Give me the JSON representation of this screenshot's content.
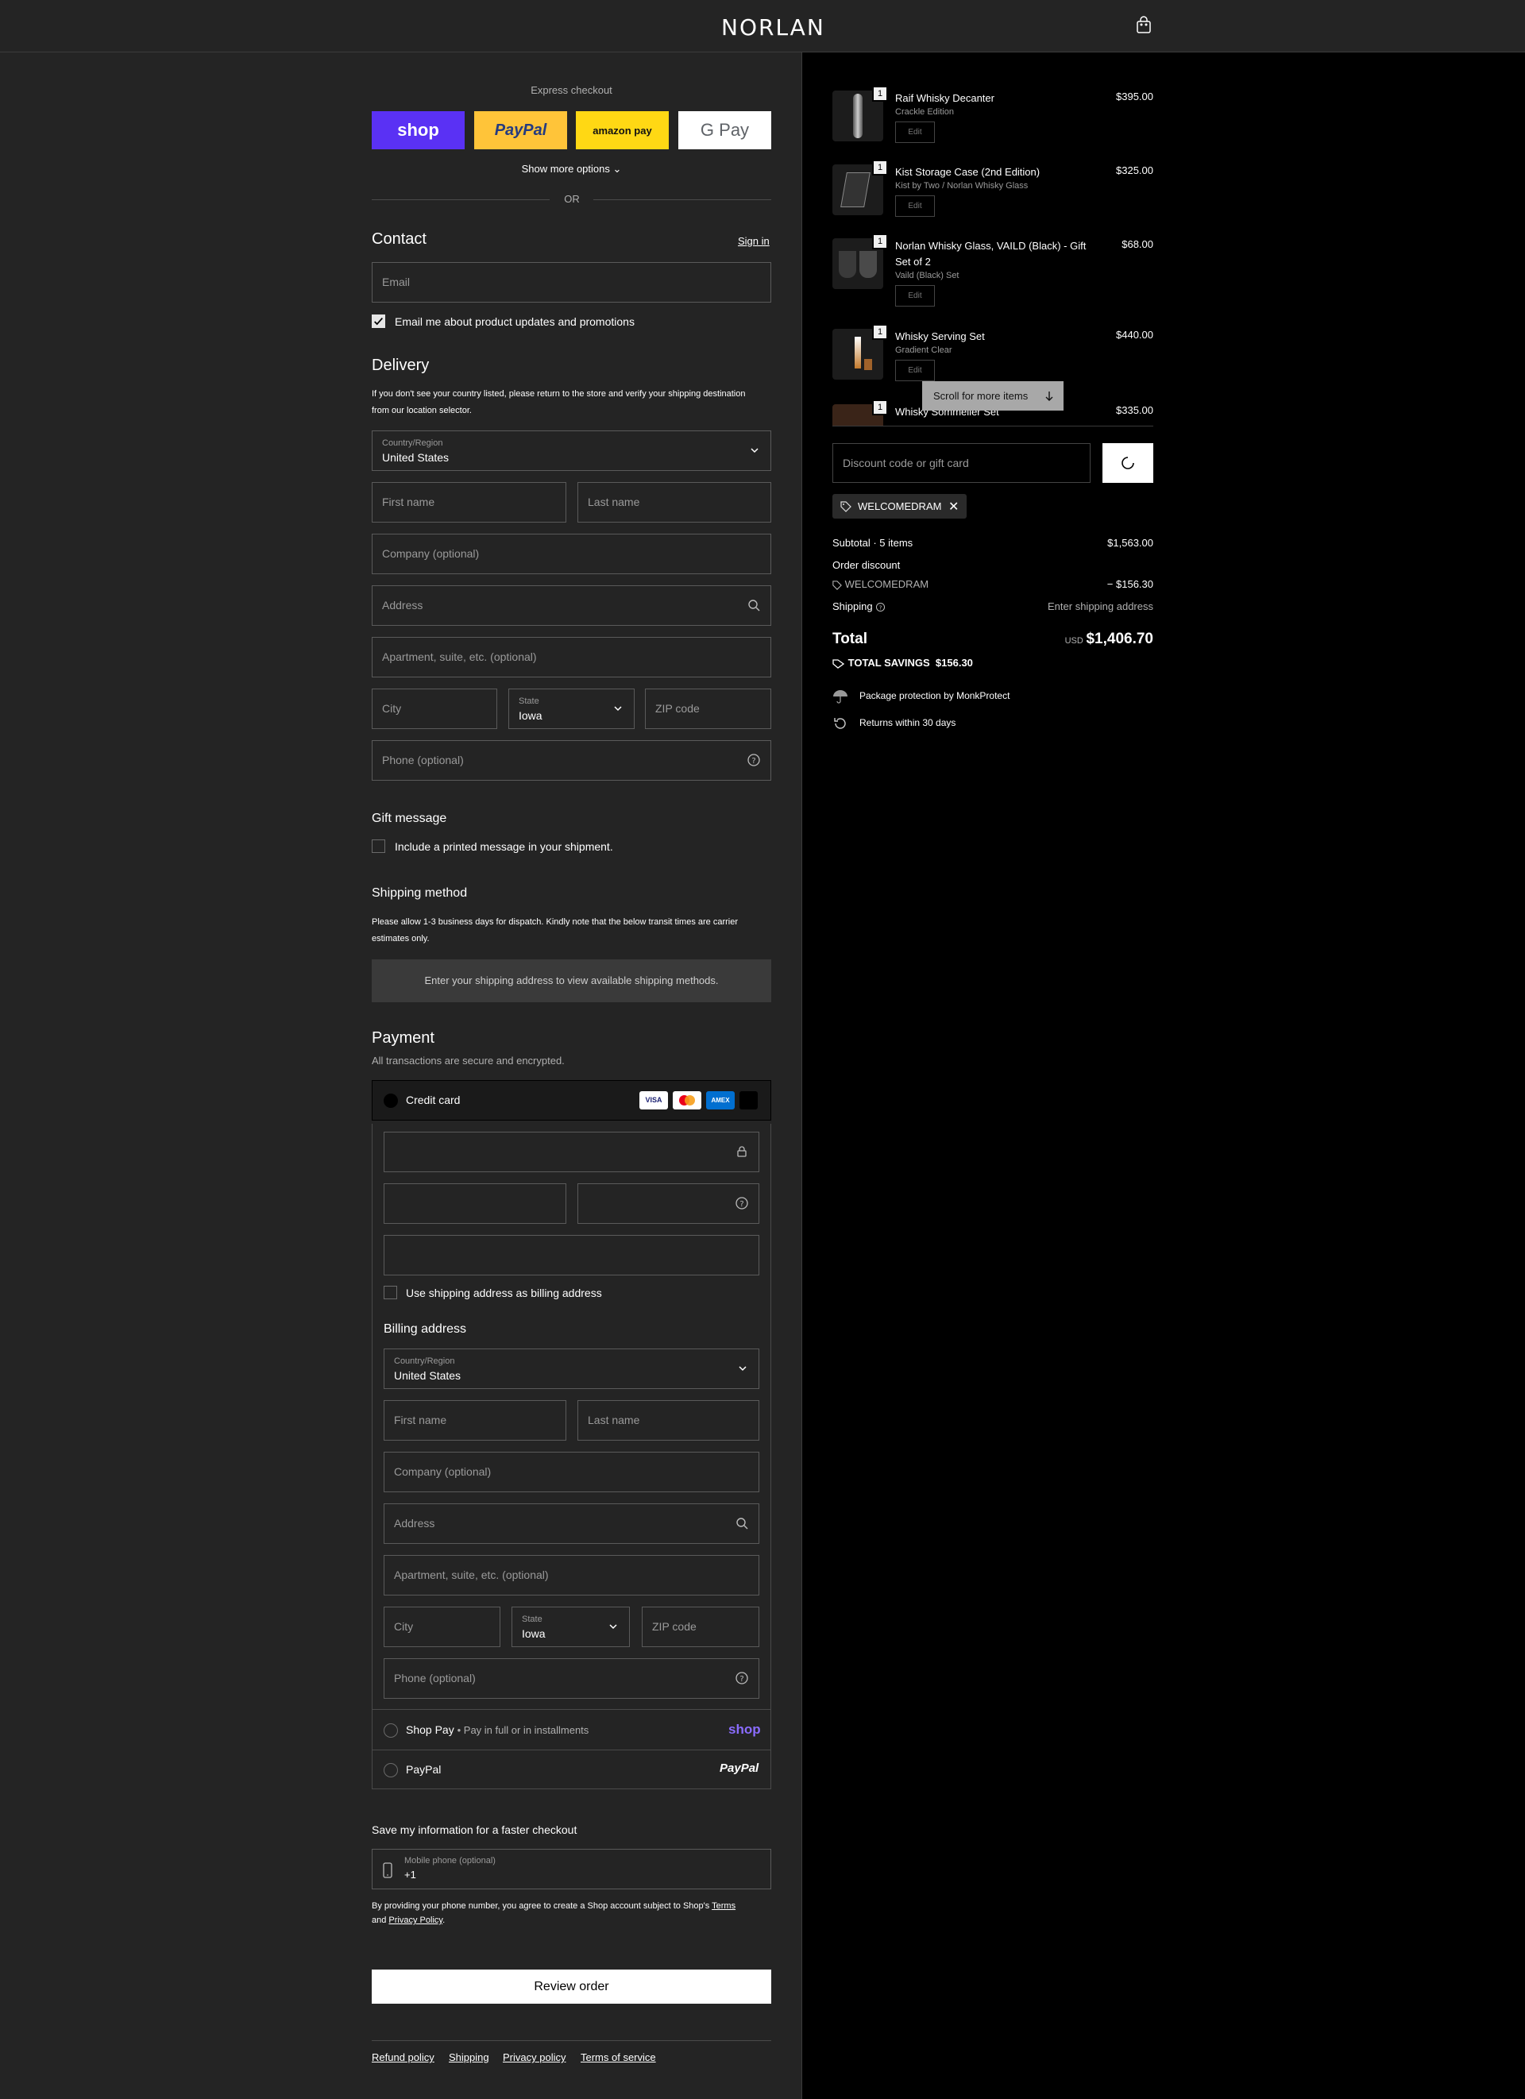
{
  "header": {
    "brand": "NORLAN",
    "cart_icon": "shopping-bag-icon"
  },
  "express": {
    "title": "Express checkout",
    "shop": "shop",
    "paypal": "PayPal",
    "amazon": "amazon pay",
    "gpay": "G Pay",
    "more": "Show more options",
    "or": "OR"
  },
  "contact": {
    "title": "Contact",
    "signin": "Sign in",
    "email_placeholder": "Email",
    "newsletter": "Email me about product updates and promotions",
    "newsletter_checked": true
  },
  "delivery": {
    "title": "Delivery",
    "note": "If you don't see your country listed, please return to the store and verify your shipping destination from our location selector.",
    "country_label": "Country/Region",
    "country": "United States",
    "first": "First name",
    "last": "Last name",
    "company": "Company (optional)",
    "address": "Address",
    "apt": "Apartment, suite, etc. (optional)",
    "city": "City",
    "state_label": "State",
    "state": "Iowa",
    "zip": "ZIP code",
    "phone": "Phone (optional)"
  },
  "gift": {
    "title": "Gift message",
    "option": "Include a printed message in your shipment."
  },
  "shipping": {
    "title": "Shipping method",
    "note": "Please allow 1-3 business days for dispatch. Kindly note that the below transit times are carrier estimates only.",
    "placeholder": "Enter your shipping address to view available shipping methods."
  },
  "payment": {
    "title": "Payment",
    "subtitle": "All transactions are secure and encrypted.",
    "credit": "Credit card",
    "cards": [
      "VISA",
      "MC",
      "AMEX",
      ""
    ],
    "use_shipping": "Use shipping address as billing address",
    "billing_title": "Billing address",
    "shoppay": "Shop Pay",
    "shoppay_sub": "Pay in full or in installments",
    "shoppay_logo": "shop",
    "paypal": "PayPal",
    "paypal_logo": "PayPal"
  },
  "save": {
    "title": "Save my information for a faster checkout",
    "phone_label": "Mobile phone (optional)",
    "phone_value": "+1",
    "terms_a": "By providing your phone number, you agree to create a Shop account subject to Shop's",
    "terms_link": "Terms",
    "terms_and": "and",
    "privacy": "Privacy Policy",
    "terms_end": "."
  },
  "review": "Review order",
  "footer": [
    "Refund policy",
    "Shipping",
    "Privacy policy",
    "Terms of service"
  ],
  "cart": {
    "items": [
      {
        "qty": "1",
        "name": "Raif Whisky Decanter",
        "variant": "Crackle Edition",
        "edit": "Edit",
        "price": "$395.00"
      },
      {
        "qty": "1",
        "name": "Kist Storage Case (2nd Edition)",
        "variant": "Kist by Two / Norlan Whisky Glass",
        "edit": "Edit",
        "price": "$325.00"
      },
      {
        "qty": "1",
        "name": "Norlan Whisky Glass, VAILD (Black) - Gift Set of 2",
        "variant": "Vaild (Black) Set",
        "edit": "Edit",
        "price": "$68.00"
      },
      {
        "qty": "1",
        "name": "Whisky Serving Set",
        "variant": "Gradient Clear",
        "edit": "Edit",
        "price": "$440.00"
      },
      {
        "qty": "1",
        "name": "Whisky Sommelier Set",
        "variant": "",
        "edit": "",
        "price": "$335.00"
      }
    ],
    "scroll_hint": "Scroll for more items",
    "discount_placeholder": "Discount code or gift card",
    "code": "WELCOMEDRAM",
    "subtotal_label": "Subtotal · 5 items",
    "subtotal": "$1,563.00",
    "order_discount": "Order discount",
    "discount_code": "WELCOMEDRAM",
    "discount_amount": "− $156.30",
    "shipping_label": "Shipping",
    "shipping_value": "Enter shipping address",
    "total_label": "Total",
    "currency": "USD",
    "total": "$1,406.70",
    "savings_label": "TOTAL SAVINGS",
    "savings": "$156.30",
    "protect": "Package protection by MonkProtect",
    "returns": "Returns within 30 days"
  }
}
